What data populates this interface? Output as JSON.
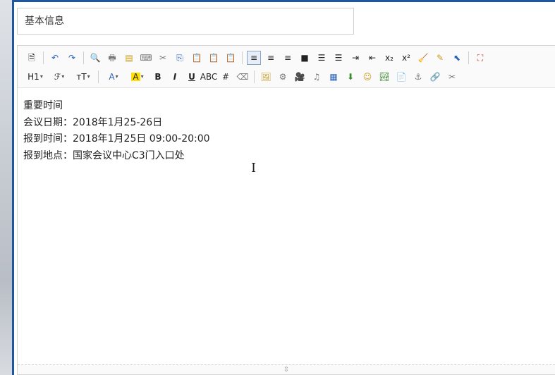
{
  "title_field": {
    "value": "基本信息"
  },
  "toolbar": {
    "row1": [
      {
        "name": "source-icon",
        "glyph": "🗎",
        "cls": "c-dark"
      },
      {
        "sep": true
      },
      {
        "name": "undo-icon",
        "glyph": "↶",
        "cls": "c-blue"
      },
      {
        "name": "redo-icon",
        "glyph": "↷",
        "cls": "c-blue"
      },
      {
        "sep": true
      },
      {
        "name": "preview-icon",
        "glyph": "🔍",
        "cls": "c-gray"
      },
      {
        "name": "print-icon",
        "glyph": "🖶",
        "cls": "c-gray"
      },
      {
        "name": "template-icon",
        "glyph": "▤",
        "cls": "c-gold"
      },
      {
        "name": "code-icon",
        "glyph": "⌨",
        "cls": "c-gray"
      },
      {
        "name": "cut-icon",
        "glyph": "✂",
        "cls": "c-gray"
      },
      {
        "name": "copy-icon",
        "glyph": "⎘",
        "cls": "c-blue"
      },
      {
        "name": "paste-icon",
        "glyph": "📋",
        "cls": "c-gold"
      },
      {
        "name": "paste-text-icon",
        "glyph": "📋",
        "cls": "c-gold"
      },
      {
        "name": "paste-word-icon",
        "glyph": "📋",
        "cls": "c-gold"
      },
      {
        "sep": true
      },
      {
        "name": "align-left-icon",
        "glyph": "≡",
        "cls": "c-dark",
        "active": true
      },
      {
        "name": "align-center-icon",
        "glyph": "≡",
        "cls": "c-dark"
      },
      {
        "name": "align-right-icon",
        "glyph": "≡",
        "cls": "c-dark"
      },
      {
        "name": "align-justify-icon",
        "glyph": "■",
        "cls": "c-dark"
      },
      {
        "name": "ordered-list-icon",
        "glyph": "☰",
        "cls": "c-dark"
      },
      {
        "name": "unordered-list-icon",
        "glyph": "☰",
        "cls": "c-dark"
      },
      {
        "name": "indent-icon",
        "glyph": "⇥",
        "cls": "c-dark"
      },
      {
        "name": "outdent-icon",
        "glyph": "⇤",
        "cls": "c-dark"
      },
      {
        "name": "subscript-icon",
        "glyph": "x₂",
        "cls": "c-dark"
      },
      {
        "name": "superscript-icon",
        "glyph": "x²",
        "cls": "c-dark"
      },
      {
        "name": "clear-format-icon",
        "glyph": "🧹",
        "cls": "c-gold"
      },
      {
        "name": "format-painter-icon",
        "glyph": "✎",
        "cls": "c-gold"
      },
      {
        "name": "select-all-icon",
        "glyph": "⬉",
        "cls": "c-blue"
      },
      {
        "sep": true
      },
      {
        "name": "fullscreen-icon",
        "glyph": "⛶",
        "cls": "c-red"
      }
    ],
    "row2": [
      {
        "name": "heading-icon",
        "glyph": "H1",
        "cls": "c-dark",
        "caret": true
      },
      {
        "name": "font-family-icon",
        "glyph": "ℱ",
        "cls": "c-dark",
        "caret": true
      },
      {
        "name": "font-size-icon",
        "glyph": "тT",
        "cls": "c-dark",
        "caret": true
      },
      {
        "sep": true
      },
      {
        "name": "font-color-icon",
        "glyph": "A",
        "cls": "c-blue",
        "caret": true
      },
      {
        "name": "highlight-color-icon",
        "glyph": "A",
        "cls": "c-dark hl",
        "caret": true
      },
      {
        "name": "bold-icon",
        "glyph": "B",
        "cls": "c-dark b"
      },
      {
        "name": "italic-icon",
        "glyph": "I",
        "cls": "c-dark i"
      },
      {
        "name": "underline-icon",
        "glyph": "U",
        "cls": "c-dark u"
      },
      {
        "name": "strikethrough-icon",
        "glyph": "ABC",
        "cls": "c-dark"
      },
      {
        "name": "table-grid-icon",
        "glyph": "#",
        "cls": "c-dark"
      },
      {
        "name": "eraser-icon",
        "glyph": "⌫",
        "cls": "c-gray"
      },
      {
        "sep": true
      },
      {
        "name": "insert-image-icon",
        "glyph": "🖼",
        "cls": "c-gold"
      },
      {
        "name": "insert-flash-icon",
        "glyph": "⚙",
        "cls": "c-gray"
      },
      {
        "name": "insert-video-icon",
        "glyph": "🎥",
        "cls": "c-gray"
      },
      {
        "name": "insert-audio-icon",
        "glyph": "♫",
        "cls": "c-gray"
      },
      {
        "name": "insert-table-icon",
        "glyph": "▦",
        "cls": "c-blue"
      },
      {
        "name": "insert-line-icon",
        "glyph": "⬇",
        "cls": "c-green"
      },
      {
        "name": "emoticon-icon",
        "glyph": "☺",
        "cls": "c-gold"
      },
      {
        "name": "insert-picture-icon",
        "glyph": "🏞",
        "cls": "c-green"
      },
      {
        "name": "page-break-icon",
        "glyph": "📄",
        "cls": "c-gray"
      },
      {
        "name": "anchor-icon",
        "glyph": "⚓",
        "cls": "c-gray"
      },
      {
        "name": "link-icon",
        "glyph": "🔗",
        "cls": "c-gray"
      },
      {
        "name": "unlink-icon",
        "glyph": "✂",
        "cls": "c-gray"
      }
    ]
  },
  "content": {
    "lines": [
      "重要时间",
      "会议日期：2018年1月25-26日",
      "报到时间：2018年1月25日 09:00-20:00",
      "报到地点：国家会议中心C3门入口处"
    ]
  },
  "cursor_glyph": "I",
  "status_grip": "⇳"
}
